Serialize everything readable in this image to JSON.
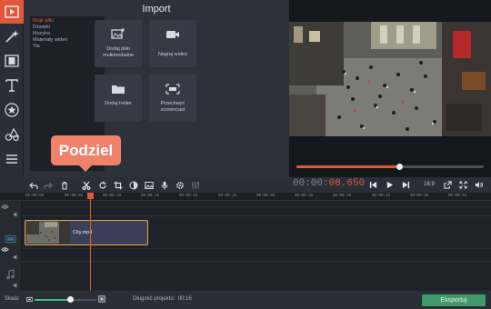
{
  "left_toolbar": {
    "icons": [
      "film-import-icon",
      "magic-wand-icon",
      "filmstrip-icon",
      "text-icon",
      "star-icon",
      "shapes-icon",
      "list-icon"
    ]
  },
  "import_panel": {
    "title": "Import",
    "categories": [
      "Moje pliki",
      "Dźwięki",
      "Muzyka",
      "Materiały wideo",
      "Tła"
    ],
    "selected_category": "Moje pliki",
    "buttons": [
      {
        "label": "Dodaj pliki multimedialne"
      },
      {
        "label": "Nagraj wideo"
      },
      {
        "label": "Dodaj folder"
      },
      {
        "label": "Przechwyć screencast"
      }
    ]
  },
  "preview": {
    "seek_progress": 0.55
  },
  "timeline_toolbar": {
    "icons": [
      "undo-icon",
      "redo-icon",
      "delete-icon",
      "scissors-icon",
      "rotate-icon",
      "crop-icon",
      "color-icon",
      "image-icon",
      "audio-icon",
      "gear-icon",
      "equalizer-icon"
    ]
  },
  "timecode": {
    "prefix": "00:00:",
    "highlight": "08.650"
  },
  "playback": {
    "aspect": "16:9"
  },
  "tooltip": {
    "label": "Podziel"
  },
  "ruler": {
    "ticks": [
      "00:00:00",
      "00:00:05",
      "00:00:10",
      "00:00:15",
      "00:00:20",
      "00:00:25",
      "00:00:30",
      "00:00:35",
      "00:00:40",
      "00:00:45",
      "00:00:50",
      "00:00:55"
    ]
  },
  "clip": {
    "name": "City.mp4"
  },
  "bottom_bar": {
    "scale_label": "Skala:",
    "scale_level": 0.58,
    "duration_label": "Długość projektu:",
    "duration_value": "00:16",
    "export_label": "Eksportuj"
  },
  "colors": {
    "accent": "#e2573c",
    "export_green": "#3f9a6a",
    "clip_border": "#e6a53a"
  }
}
